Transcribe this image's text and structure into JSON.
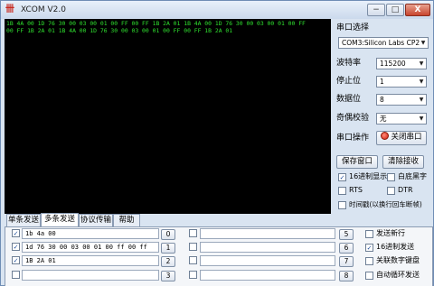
{
  "window": {
    "title": "XCOM V2.0",
    "icon": "xcom-logo-icon",
    "minimize": "−",
    "maximize": "□",
    "close": "X"
  },
  "console": {
    "lines": [
      "1B 4A 00 1D 76 30 00 03 00 01 00 FF 00 FF 1B 2A 01 1B 4A 00 1D 76 30 00 03 00 01 00 FF",
      "00 FF 1B 2A 01 1B 4A 00 1D 76 30 00 03 00 01 00 FF 00 FF 1B 2A 01"
    ]
  },
  "settings": {
    "port_label": "串口选择",
    "port_value": "COM3:Silicon Labs CP2",
    "baud_label": "波特率",
    "baud_value": "115200",
    "stop_label": "停止位",
    "stop_value": "1",
    "data_label": "数据位",
    "data_value": "8",
    "parity_label": "奇偶校验",
    "parity_value": "无",
    "op_label": "串口操作",
    "close_port": "关闭串口",
    "save_window": "保存窗口",
    "clear_recv": "清除接收",
    "hex_display": "16进制显示",
    "white_black": "白底黑字",
    "rts": "RTS",
    "dtr": "DTR",
    "timestamp": "时间戳(以换行回车断帧)"
  },
  "tabs": [
    "单条发送",
    "多条发送",
    "协议传输",
    "帮助"
  ],
  "multi_send": {
    "left_rows": [
      {
        "checked": true,
        "text": "1b 4a 00",
        "num": "0"
      },
      {
        "checked": true,
        "text": "1d 76 30 00 03 00 01 00 ff 00 ff",
        "num": "1"
      },
      {
        "checked": true,
        "text": "1B 2A 01",
        "num": "2"
      },
      {
        "checked": false,
        "text": "",
        "num": "3"
      }
    ],
    "right_rows": [
      {
        "checked": false,
        "text": "",
        "num": "5"
      },
      {
        "checked": false,
        "text": "",
        "num": "6"
      },
      {
        "checked": false,
        "text": "",
        "num": "7"
      },
      {
        "checked": false,
        "text": "",
        "num": "8"
      }
    ],
    "options": [
      {
        "checked": false,
        "label": "发送新行"
      },
      {
        "checked": true,
        "label": "16进制发送"
      },
      {
        "checked": false,
        "label": "关联数字键盘"
      },
      {
        "checked": false,
        "label": "自动循环发送"
      }
    ]
  }
}
